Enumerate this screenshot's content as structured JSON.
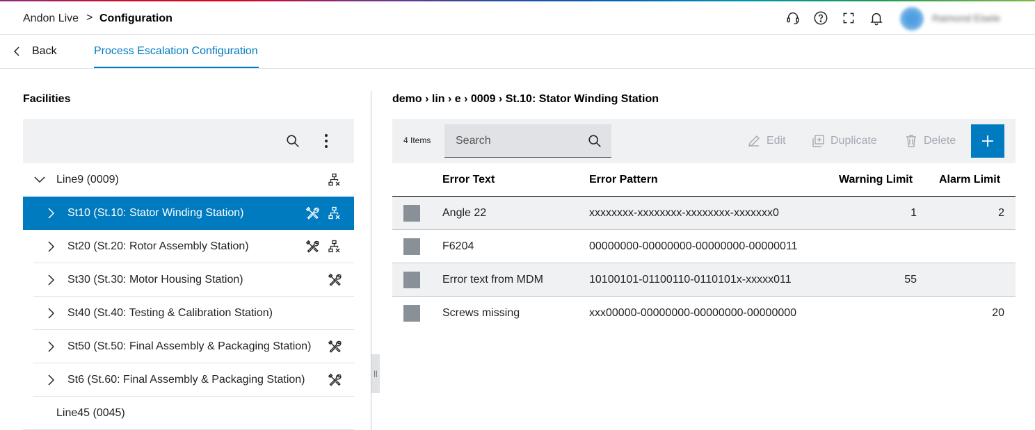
{
  "header": {
    "app_name": "Andon Live",
    "separator": ">",
    "current_page": "Configuration",
    "icons": [
      "headset-icon",
      "help-icon",
      "fullscreen-icon",
      "bell-icon"
    ],
    "user_name": "Raimond Eisele"
  },
  "tabs": {
    "back_label": "Back",
    "active_tab": "Process Escalation Configuration"
  },
  "facilities": {
    "title": "Facilities",
    "tree": [
      {
        "label": "Line9 (0009)",
        "level": 0,
        "expanded": true
      },
      {
        "label": "St10 (St.10: Stator Winding Station)",
        "level": 1,
        "selected": true
      },
      {
        "label": "St20 (St.20: Rotor Assembly Station)",
        "level": 1
      },
      {
        "label": "St30 (St.30: Motor Housing Station)",
        "level": 1
      },
      {
        "label": "St40 (St.40: Testing & Calibration Station)",
        "level": 1
      },
      {
        "label": "St50 (St.50: Final Assembly & Packaging Station)",
        "level": 1
      },
      {
        "label": "St6 (St.60: Final Assembly & Packaging Station)",
        "level": 1
      },
      {
        "label": "Line45 (0045)",
        "level": 0
      }
    ]
  },
  "details": {
    "path": "demo › lin › e › 0009 › St.10: Stator Winding Station",
    "items_count": "4 Items",
    "search_placeholder": "Search",
    "edit_label": "Edit",
    "duplicate_label": "Duplicate",
    "delete_label": "Delete",
    "columns": {
      "error_text": "Error Text",
      "error_pattern": "Error Pattern",
      "warning_limit": "Warning Limit",
      "alarm_limit": "Alarm Limit"
    },
    "rows": [
      {
        "error_text": "Angle 22",
        "error_pattern": "xxxxxxxx-xxxxxxxx-xxxxxxxx-xxxxxxx0",
        "warning_limit": "1",
        "alarm_limit": "2"
      },
      {
        "error_text": "F6204",
        "error_pattern": "00000000-00000000-00000000-00000011",
        "warning_limit": "",
        "alarm_limit": ""
      },
      {
        "error_text": "Error text from MDM",
        "error_pattern": "10100101-01100110-0110101x-xxxxx011",
        "warning_limit": "55",
        "alarm_limit": ""
      },
      {
        "error_text": "Screws missing",
        "error_pattern": "xxx00000-00000000-00000000-00000000",
        "warning_limit": "",
        "alarm_limit": "20"
      }
    ]
  },
  "colors": {
    "primary": "#007bc0",
    "toolbar_bg": "#eff1f2",
    "disabled_text": "#a4abb3"
  }
}
